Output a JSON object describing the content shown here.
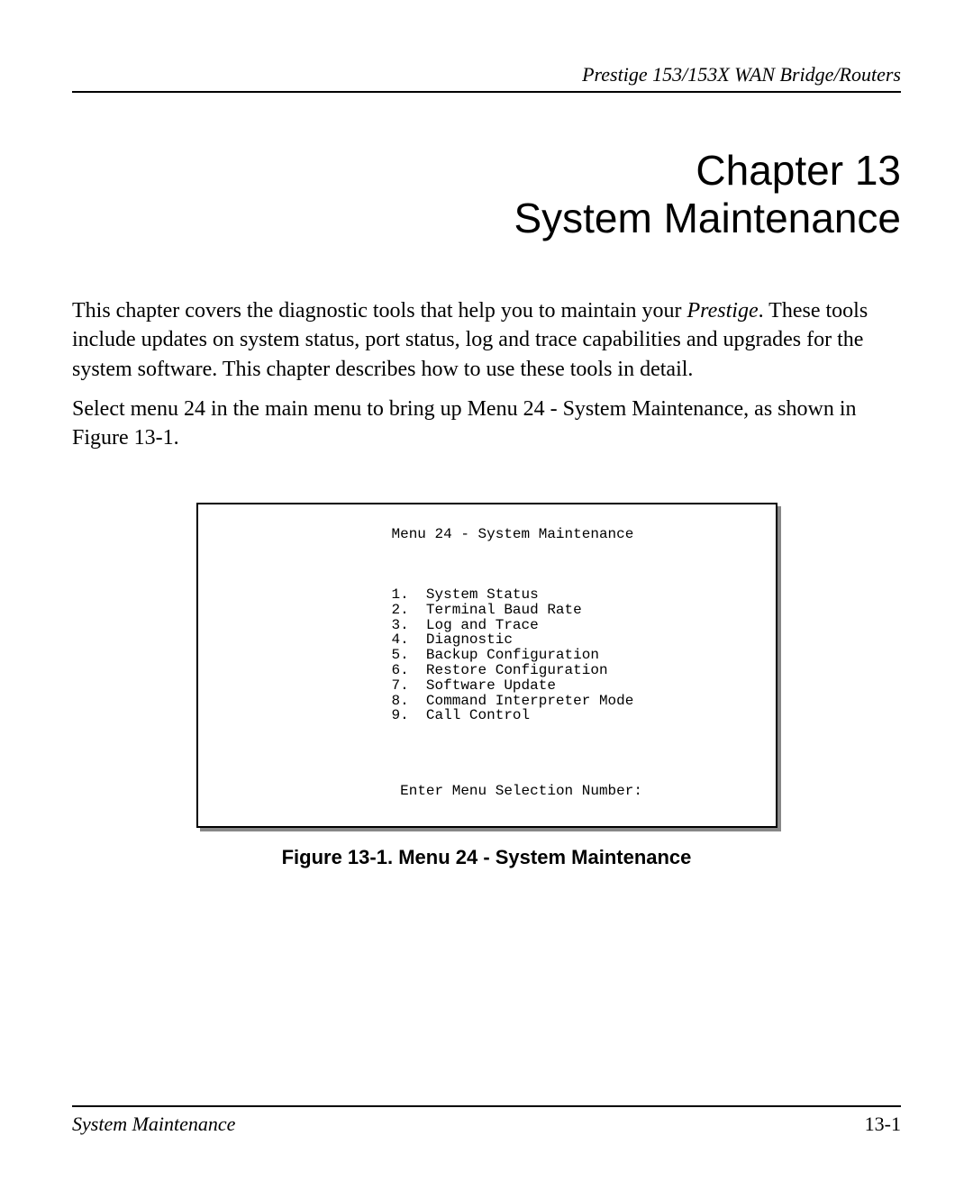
{
  "header": {
    "running_head": "Prestige 153/153X  WAN Bridge/Routers"
  },
  "chapter": {
    "number_line": "Chapter 13",
    "title_line": "System Maintenance"
  },
  "body": {
    "p1_a": "This chapter covers the diagnostic tools that help you to maintain your ",
    "p1_italic": "Prestige",
    "p1_b": ".  These tools include updates on system status, port status, log and trace capabilities and upgrades for the system software. This chapter describes how to use these tools in detail.",
    "p2": "Select menu 24 in the main menu to bring up Menu 24 - System Maintenance, as shown in Figure 13-1."
  },
  "terminal": {
    "title": "Menu 24 - System Maintenance",
    "items": [
      "1.  System Status",
      "2.  Terminal Baud Rate",
      "3.  Log and Trace",
      "4.  Diagnostic",
      "5.  Backup Configuration",
      "6.  Restore Configuration",
      "7.  Software Update",
      "8.  Command Interpreter Mode",
      "9.  Call Control"
    ],
    "prompt": "Enter Menu Selection Number:"
  },
  "figure_caption": "Figure 13-1.     Menu 24 - System Maintenance",
  "footer": {
    "left": "System Maintenance",
    "right": "13-1"
  }
}
